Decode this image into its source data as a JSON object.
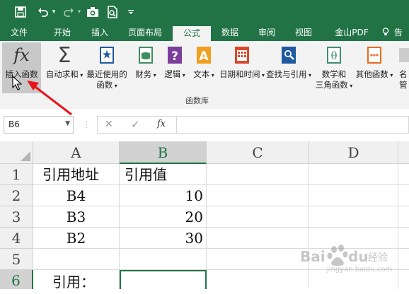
{
  "quick_access": {
    "save_icon": "save-icon",
    "undo_icon": "undo-icon",
    "redo_icon": "redo-icon",
    "camera_icon": "camera-icon",
    "preview_icon": "print-preview-icon",
    "customize_icon": "customize-quick-access-icon"
  },
  "tabs": [
    {
      "label": "文件"
    },
    {
      "label": "开始"
    },
    {
      "label": "插入"
    },
    {
      "label": "页面布局"
    },
    {
      "label": "公式"
    },
    {
      "label": "数据"
    },
    {
      "label": "审阅"
    },
    {
      "label": "视图"
    },
    {
      "label": "金山PDF"
    },
    {
      "label": "告"
    }
  ],
  "ribbon": {
    "insert_function": {
      "icon_text": "fx",
      "label": "插入函数"
    },
    "autosum": {
      "label": "自动求和"
    },
    "recent": {
      "label_line1": "最近使用的",
      "label_line2": "函数"
    },
    "financial": {
      "label": "财务"
    },
    "logical": {
      "label": "逻辑"
    },
    "text": {
      "label": "文本"
    },
    "datetime": {
      "label": "日期和时间"
    },
    "lookup": {
      "label": "查找与引用"
    },
    "math": {
      "label_line1": "数学和",
      "label_line2": "三角函数"
    },
    "more": {
      "label": "其他函数"
    },
    "partial": {
      "label_line1": "名",
      "label_line2": "管"
    },
    "group_label": "函数库"
  },
  "formula_bar": {
    "name_box": "B6",
    "cancel_icon": "cancel-icon",
    "enter_icon": "enter-icon",
    "fx_label": "fx",
    "formula": ""
  },
  "sheet": {
    "columns": [
      "A",
      "B",
      "C",
      "D"
    ],
    "rows": [
      "1",
      "2",
      "3",
      "4",
      "5",
      "6"
    ],
    "cells": {
      "A1": "引用地址",
      "B1": "引用值",
      "A2": "B4",
      "B2": "10",
      "A3": "B3",
      "B3": "20",
      "A4": "B2",
      "B4": "30",
      "A6": "引用：",
      "B6": ""
    }
  },
  "colors": {
    "brand": "#217346",
    "annotation": "#e8141b"
  },
  "watermark": "Baidu 经验 jingyan.baidu.com"
}
